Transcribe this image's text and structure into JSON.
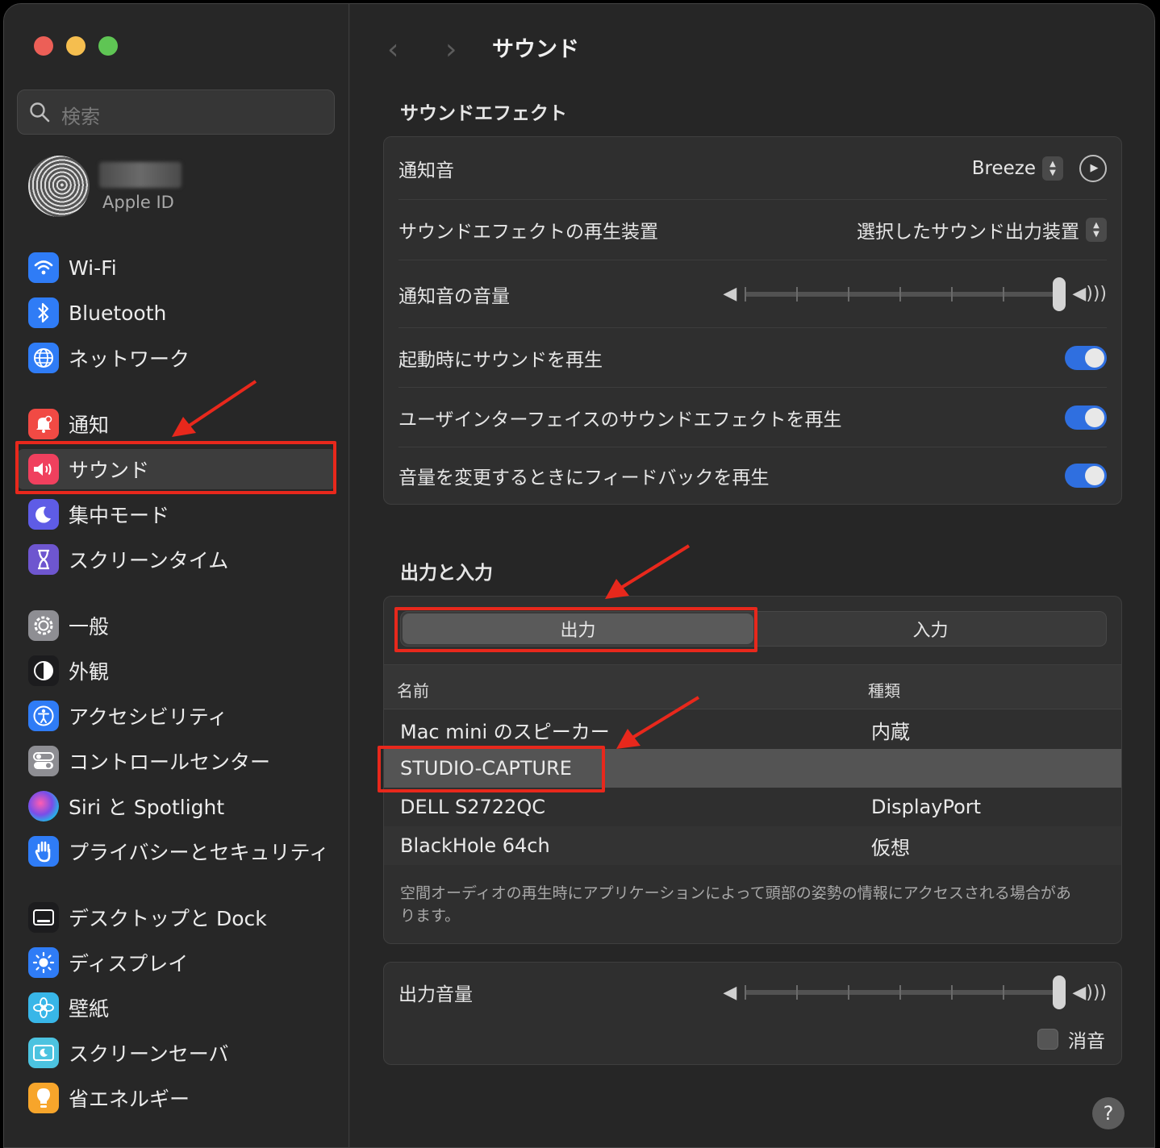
{
  "window": {
    "traffic_lights": [
      "#ec5f57",
      "#f5be4f",
      "#5fc554"
    ]
  },
  "search": {
    "placeholder": "検索"
  },
  "apple_id": {
    "label": "Apple ID"
  },
  "sidebar": {
    "items": [
      {
        "label": "Wi-Fi",
        "icon": "wifi-icon",
        "color": "#2f7cf6"
      },
      {
        "label": "Bluetooth",
        "icon": "bluetooth-icon",
        "color": "#2f7cf6"
      },
      {
        "label": "ネットワーク",
        "icon": "globe-icon",
        "color": "#2f7cf6"
      },
      {
        "label": "通知",
        "icon": "bell-icon",
        "color": "#f14a44"
      },
      {
        "label": "サウンド",
        "icon": "speaker-icon",
        "color": "#f0405e"
      },
      {
        "label": "集中モード",
        "icon": "moon-icon",
        "color": "#5e5ce6"
      },
      {
        "label": "スクリーンタイム",
        "icon": "hourglass-icon",
        "color": "#6e56cf"
      },
      {
        "label": "一般",
        "icon": "gear-icon",
        "color": "#8e8e93"
      },
      {
        "label": "外観",
        "icon": "appearance-icon",
        "color": "#1c1c1e"
      },
      {
        "label": "アクセシビリティ",
        "icon": "accessibility-icon",
        "color": "#2f7cf6"
      },
      {
        "label": "コントロールセンター",
        "icon": "toggles-icon",
        "color": "#8e8e93"
      },
      {
        "label": "Siri と Spotlight",
        "icon": "siri-icon",
        "color": "#9b4de0"
      },
      {
        "label": "プライバシーとセキュリティ",
        "icon": "hand-icon",
        "color": "#2f7cf6"
      },
      {
        "label": "デスクトップと Dock",
        "icon": "dock-icon",
        "color": "#1c1c1e"
      },
      {
        "label": "ディスプレイ",
        "icon": "sun-icon",
        "color": "#2f7cf6"
      },
      {
        "label": "壁紙",
        "icon": "flower-icon",
        "color": "#38b6e8"
      },
      {
        "label": "スクリーンセーバ",
        "icon": "screensaver-icon",
        "color": "#4cc3e0"
      },
      {
        "label": "省エネルギー",
        "icon": "bulb-icon",
        "color": "#f7a52b"
      }
    ],
    "selected": "サウンド"
  },
  "header": {
    "title": "サウンド",
    "back": "‹",
    "forward": "›"
  },
  "sound_effects": {
    "title": "サウンドエフェクト",
    "alert_sound": {
      "label": "通知音",
      "value": "Breeze"
    },
    "play_device": {
      "label": "サウンドエフェクトの再生装置",
      "value": "選択したサウンド出力装置"
    },
    "alert_volume": {
      "label": "通知音の音量",
      "level": 1.0
    },
    "startup_sound": {
      "label": "起動時にサウンドを再生",
      "on": true
    },
    "ui_sounds": {
      "label": "ユーザインターフェイスのサウンドエフェクトを再生",
      "on": true
    },
    "volume_feedback": {
      "label": "音量を変更するときにフィードバックを再生",
      "on": true
    }
  },
  "output_input": {
    "title": "出力と入力",
    "tabs": [
      "出力",
      "入力"
    ],
    "selected_tab": "出力",
    "columns": [
      "名前",
      "種類"
    ],
    "devices": [
      {
        "name": "Mac mini のスピーカー",
        "type": "内蔵"
      },
      {
        "name": "STUDIO-CAPTURE",
        "type": ""
      },
      {
        "name": "DELL S2722QC",
        "type": "DisplayPort"
      },
      {
        "name": "BlackHole 64ch",
        "type": "仮想"
      }
    ],
    "selected_device": "STUDIO-CAPTURE",
    "note": "空間オーディオの再生時にアプリケーションによって頭部の姿勢の情報にアクセスされる場合があります。"
  },
  "output_volume": {
    "label": "出力音量",
    "level": 1.0,
    "mute_label": "消音",
    "muted": false
  },
  "help": {
    "label": "?"
  },
  "annotation_color": "#e8281c"
}
